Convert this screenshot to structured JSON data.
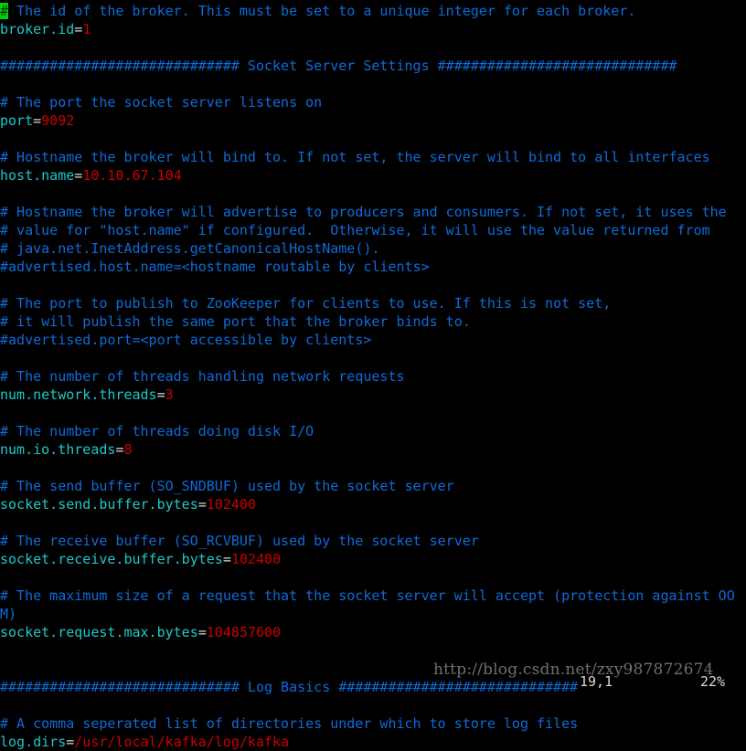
{
  "terminal": {
    "background_color": "#000000",
    "comment_color": "#0f6bd8",
    "key_color": "#1ec8c8",
    "equals_color": "#d9d9d9",
    "value_color": "#cc0000",
    "cursor_color": "#00d400",
    "status_color": "#d9d9d9"
  },
  "watermark": {
    "text": "http://blog.csdn.net/zxy987872674"
  },
  "statusline": {
    "position": "19,1",
    "percent": "22%"
  },
  "editor": {
    "cursor": {
      "char": "#",
      "line": 1,
      "column": 1
    },
    "lines": [
      {
        "type": "comment-cursor",
        "cursor_char": "#",
        "text": " The id of the broker. This must be set to a unique integer for each broker."
      },
      {
        "type": "setting",
        "key": "broker.id",
        "eq": "=",
        "value": "1"
      },
      {
        "type": "blank",
        "text": ""
      },
      {
        "type": "comment",
        "text": "############################# Socket Server Settings #############################"
      },
      {
        "type": "blank",
        "text": ""
      },
      {
        "type": "comment",
        "text": "# The port the socket server listens on"
      },
      {
        "type": "setting",
        "key": "port",
        "eq": "=",
        "value": "9092"
      },
      {
        "type": "blank",
        "text": ""
      },
      {
        "type": "comment",
        "text": "# Hostname the broker will bind to. If not set, the server will bind to all interfaces"
      },
      {
        "type": "setting",
        "key": "host.name",
        "eq": "=",
        "value": "10.10.67.104"
      },
      {
        "type": "blank",
        "text": ""
      },
      {
        "type": "comment",
        "text": "# Hostname the broker will advertise to producers and consumers. If not set, it uses the"
      },
      {
        "type": "comment",
        "text": "# value for \"host.name\" if configured.  Otherwise, it will use the value returned from"
      },
      {
        "type": "comment",
        "text": "# java.net.InetAddress.getCanonicalHostName()."
      },
      {
        "type": "comment",
        "text": "#advertised.host.name=<hostname routable by clients>"
      },
      {
        "type": "blank",
        "text": ""
      },
      {
        "type": "comment",
        "text": "# The port to publish to ZooKeeper for clients to use. If this is not set,"
      },
      {
        "type": "comment",
        "text": "# it will publish the same port that the broker binds to."
      },
      {
        "type": "comment",
        "text": "#advertised.port=<port accessible by clients>"
      },
      {
        "type": "blank",
        "text": ""
      },
      {
        "type": "comment",
        "text": "# The number of threads handling network requests"
      },
      {
        "type": "setting",
        "key": "num.network.threads",
        "eq": "=",
        "value": "3"
      },
      {
        "type": "blank",
        "text": ""
      },
      {
        "type": "comment",
        "text": "# The number of threads doing disk I/O"
      },
      {
        "type": "setting",
        "key": "num.io.threads",
        "eq": "=",
        "value": "8"
      },
      {
        "type": "blank",
        "text": ""
      },
      {
        "type": "comment",
        "text": "# The send buffer (SO_SNDBUF) used by the socket server"
      },
      {
        "type": "setting",
        "key": "socket.send.buffer.bytes",
        "eq": "=",
        "value": "102400"
      },
      {
        "type": "blank",
        "text": ""
      },
      {
        "type": "comment",
        "text": "# The receive buffer (SO_RCVBUF) used by the socket server"
      },
      {
        "type": "setting",
        "key": "socket.receive.buffer.bytes",
        "eq": "=",
        "value": "102400"
      },
      {
        "type": "blank",
        "text": ""
      },
      {
        "type": "comment",
        "text": "# The maximum size of a request that the socket server will accept (protection against OO"
      },
      {
        "type": "comment",
        "text": "M)"
      },
      {
        "type": "setting",
        "key": "socket.request.max.bytes",
        "eq": "=",
        "value": "104857600"
      },
      {
        "type": "blank",
        "text": ""
      },
      {
        "type": "blank",
        "text": ""
      },
      {
        "type": "comment",
        "text": "############################# Log Basics #############################"
      },
      {
        "type": "blank",
        "text": ""
      },
      {
        "type": "comment",
        "text": "# A comma seperated list of directories under which to store log files"
      },
      {
        "type": "setting",
        "key": "log.dirs",
        "eq": "=",
        "value": "/usr/local/kafka/log/kafka"
      }
    ]
  }
}
